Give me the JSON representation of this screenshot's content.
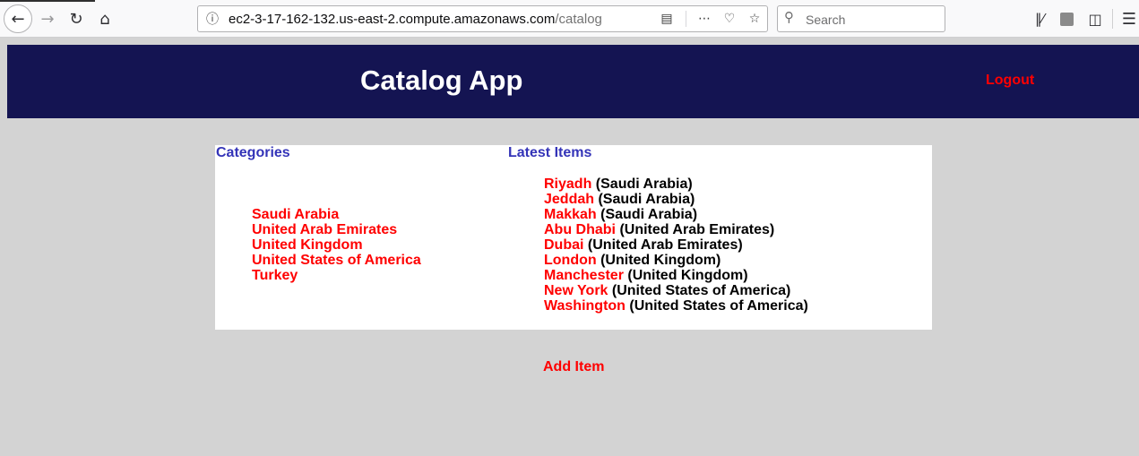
{
  "browser": {
    "url_host": "ec2-3-17-162-132.us-east-2.compute.amazonaws.com",
    "url_path": "/catalog",
    "search_placeholder": "Search"
  },
  "header": {
    "title": "Catalog App",
    "logout_label": "Logout"
  },
  "categories": {
    "heading": "Categories",
    "items": [
      "Saudi Arabia",
      "United Arab Emirates",
      "United Kingdom",
      "United States of America",
      "Turkey"
    ]
  },
  "latest": {
    "heading": "Latest Items",
    "items": [
      {
        "name": "Riyadh",
        "category": "(Saudi Arabia)"
      },
      {
        "name": "Jeddah",
        "category": "(Saudi Arabia)"
      },
      {
        "name": "Makkah",
        "category": "(Saudi Arabia)"
      },
      {
        "name": "Abu Dhabi",
        "category": "(United Arab Emirates)"
      },
      {
        "name": "Dubai",
        "category": "(United Arab Emirates)"
      },
      {
        "name": "London",
        "category": "(United Kingdom)"
      },
      {
        "name": "Manchester",
        "category": "(United Kingdom)"
      },
      {
        "name": "New York",
        "category": "(United States of America)"
      },
      {
        "name": "Washington",
        "category": "(United States of America)"
      }
    ]
  },
  "actions": {
    "add_item_label": "Add Item"
  },
  "colors": {
    "header_bg": "#141452",
    "link_red": "#ff0000",
    "heading_blue": "#3434b8",
    "page_bg": "#d3d3d3"
  }
}
